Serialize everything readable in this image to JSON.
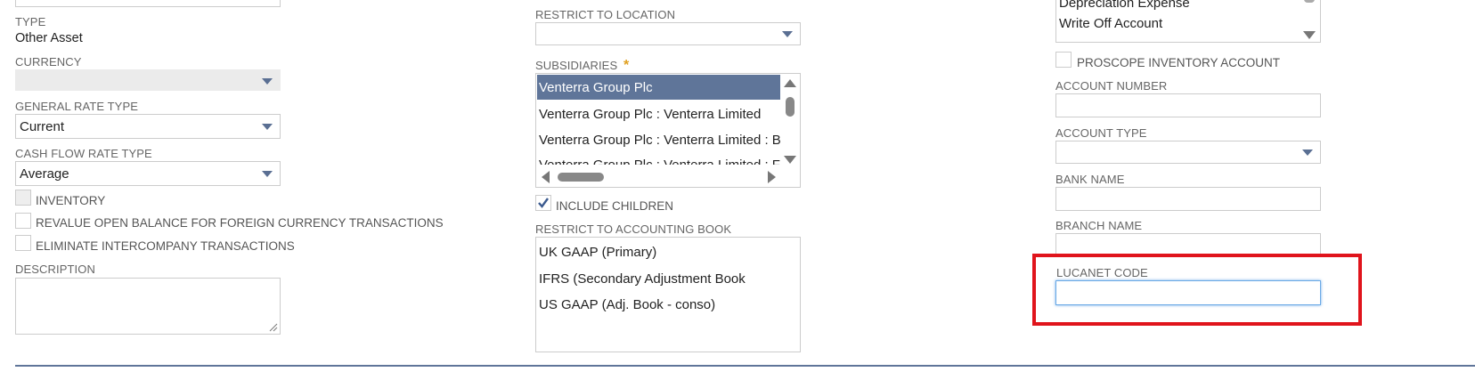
{
  "left": {
    "type_label": "TYPE",
    "type_value": "Other Asset",
    "currency_label": "CURRENCY",
    "currency_value": "",
    "general_rate_label": "GENERAL RATE TYPE",
    "general_rate_value": "Current",
    "cash_flow_label": "CASH FLOW RATE TYPE",
    "cash_flow_value": "Average",
    "inventory_label": "INVENTORY",
    "revalue_label": "REVALUE OPEN BALANCE FOR FOREIGN CURRENCY TRANSACTIONS",
    "eliminate_label": "ELIMINATE INTERCOMPANY TRANSACTIONS",
    "description_label": "DESCRIPTION",
    "description_value": ""
  },
  "middle": {
    "restrict_location_label": "RESTRICT TO LOCATION",
    "restrict_location_value": "",
    "subsidiaries_label": "SUBSIDIARIES",
    "required_marker": "*",
    "subsidiaries": [
      "Venterra Group Plc",
      "Venterra Group Plc : Venterra Limited",
      "Venterra Group Plc : Venterra Limited : Bal",
      "Venterra Group Plc : Venterra Limited : Fo"
    ],
    "include_children_label": "INCLUDE CHILDREN",
    "include_children_checked": true,
    "accounting_book_label": "RESTRICT TO ACCOUNTING BOOK",
    "accounting_books": [
      "UK GAAP (Primary)",
      "IFRS (Secondary Adjustment Book",
      "US GAAP (Adj. Book - conso)"
    ]
  },
  "right": {
    "list_items": [
      "Depreciation Expense",
      "Write Off Account"
    ],
    "proscope_label": "PROSCOPE INVENTORY ACCOUNT",
    "account_number_label": "ACCOUNT NUMBER",
    "account_type_label": "ACCOUNT TYPE",
    "bank_name_label": "BANK NAME",
    "branch_name_label": "BRANCH NAME",
    "lucanet_label": "LUCANET CODE",
    "lucanet_value": ""
  },
  "colors": {
    "selected_row": "#5f7599",
    "highlight": "#e0141c",
    "focus_border": "#6aa9e6",
    "required": "#e0a020"
  }
}
